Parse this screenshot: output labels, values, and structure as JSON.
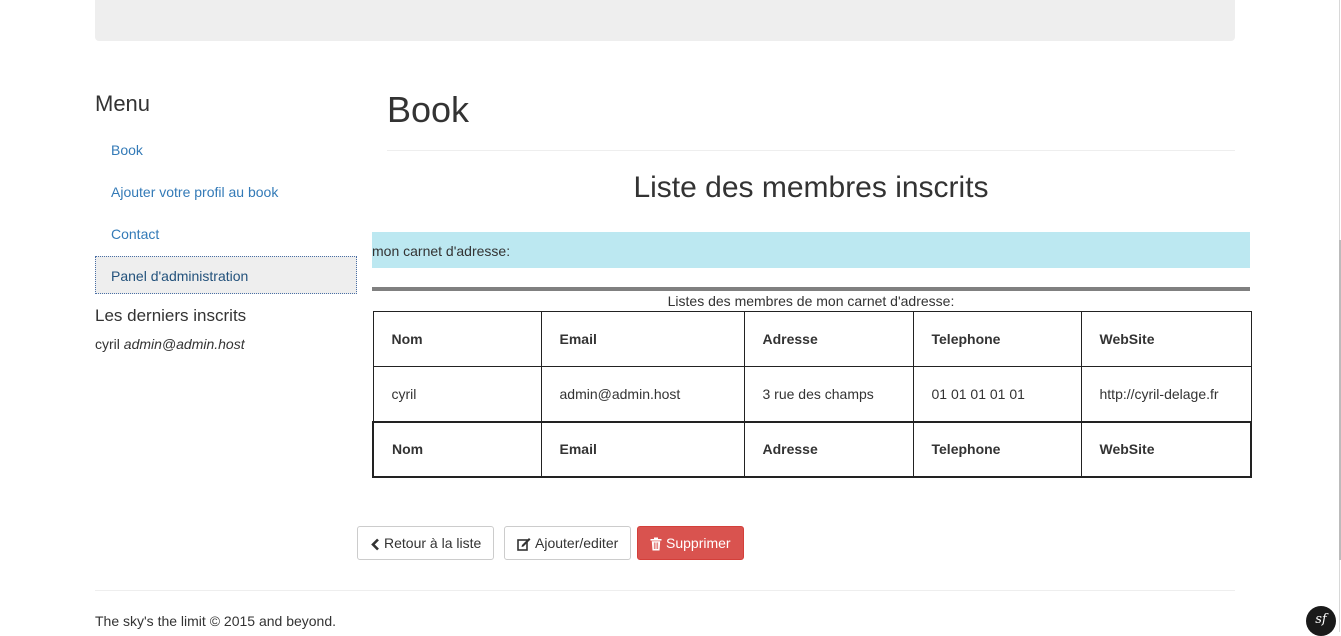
{
  "sidebar": {
    "title": "Menu",
    "items": [
      {
        "label": "Book"
      },
      {
        "label": "Ajouter votre profil au book"
      },
      {
        "label": "Contact"
      },
      {
        "label": "Panel d'administration"
      }
    ],
    "latest_title": "Les derniers inscrits",
    "latest_name": "cyril",
    "latest_email": "admin@admin.host"
  },
  "main": {
    "title": "Book",
    "list_heading": "Liste des membres inscrits",
    "info_text": "mon carnet d'adresse:",
    "caption": "Listes des membres de mon carnet d'adresse:",
    "table": {
      "headers": [
        "Nom",
        "Email",
        "Adresse",
        "Telephone",
        "WebSite"
      ],
      "rows": [
        [
          "cyril",
          "admin@admin.host",
          "3 rue des champs",
          "01 01 01 01 01",
          "http://cyril-delage.fr"
        ]
      ]
    }
  },
  "actions": {
    "back_label": "Retour à la liste",
    "edit_label": "Ajouter/editer",
    "delete_label": "Supprimer",
    "back_icon": "chevron-left-icon",
    "edit_icon": "edit-icon",
    "delete_icon": "trash-icon"
  },
  "footer": {
    "text": "The sky's the limit © 2015 and beyond.",
    "badge": "sf"
  },
  "colors": {
    "link": "#337ab7",
    "info_bg": "#bce8f1",
    "danger": "#d9534f"
  }
}
